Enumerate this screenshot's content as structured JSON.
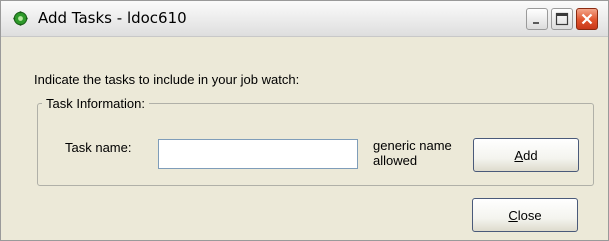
{
  "window": {
    "title": "Add Tasks - ldoc610"
  },
  "dialog": {
    "prompt": "Indicate the tasks to include in your job watch:",
    "group_title": "Task Information:",
    "task_name_label": "Task name:",
    "task_name_value": "",
    "hint_line1": "generic name",
    "hint_line2": "allowed",
    "add_button": {
      "mnemonic": "A",
      "rest": "dd"
    },
    "close_button": {
      "mnemonic": "C",
      "rest": "lose"
    }
  },
  "icons": {
    "app": "green-gear-icon",
    "minimize": "minimize-icon",
    "maximize": "maximize-icon",
    "close": "close-icon"
  },
  "colors": {
    "dialog_background": "#ece9d8",
    "close_button": "#e0532c",
    "app_icon": "#2e9a2a"
  }
}
